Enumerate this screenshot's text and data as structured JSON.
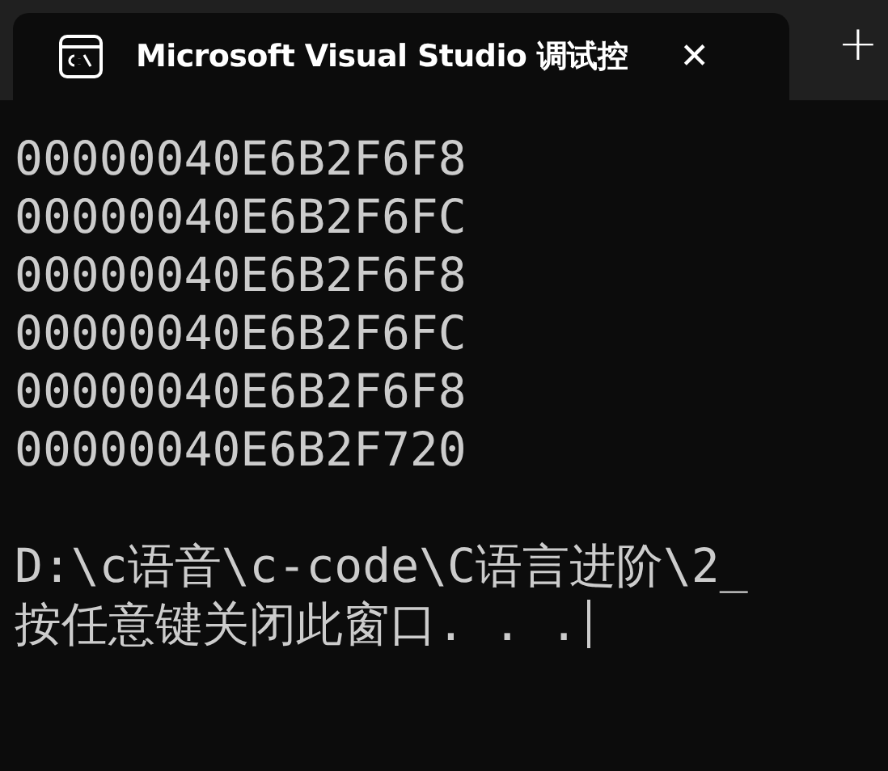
{
  "tab": {
    "title": "Microsoft Visual Studio 调试控",
    "close": "✕",
    "new_tab": "+",
    "selected": true
  },
  "console": {
    "lines": [
      "00000040E6B2F6F8",
      "00000040E6B2F6FC",
      "00000040E6B2F6F8",
      "00000040E6B2F6FC",
      "00000040E6B2F6F8",
      "00000040E6B2F720"
    ],
    "after_gap": [
      "D:\\c语音\\c-code\\C语言进阶\\2_",
      "按任意键关闭此窗口. . ."
    ],
    "cursor": true
  }
}
